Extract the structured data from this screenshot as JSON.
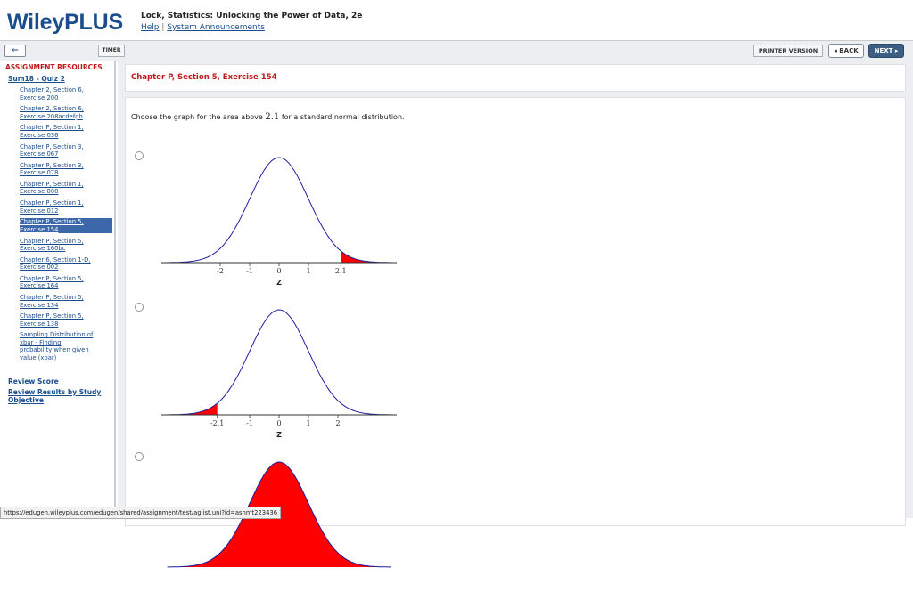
{
  "header": {
    "logo": "WileyPLUS",
    "course_title": "Lock, Statistics: Unlocking the Power of Data, 2e",
    "help_link": "Help",
    "separator": "|",
    "announcements_link": "System Announcements"
  },
  "toolbar": {
    "collapse_icon": "⇐",
    "timer": "TIMER",
    "printer_version": "PRINTER VERSION",
    "back": "◂ BACK",
    "next": "NEXT ▸"
  },
  "sidebar": {
    "heading": "ASSIGNMENT RESOURCES",
    "assignment": "Sum18 - Quiz 2",
    "items": [
      {
        "line1": "Chapter 2, Section 6,",
        "line2": "Exercise 200"
      },
      {
        "line1": "Chapter 2, Section 6,",
        "line2": "Exercise 208acdefgh"
      },
      {
        "line1": "Chapter P, Section 1,",
        "line2": "Exercise 036"
      },
      {
        "line1": "Chapter P, Section 3,",
        "line2": "Exercise 067"
      },
      {
        "line1": "Chapter P, Section 3,",
        "line2": "Exercise 078"
      },
      {
        "line1": "Chapter P, Section 1,",
        "line2": "Exercise 008"
      },
      {
        "line1": "Chapter P, Section 1,",
        "line2": "Exercise 012"
      },
      {
        "line1": "Chapter P, Section 5,",
        "line2": "Exercise 154"
      },
      {
        "line1": "Chapter P, Section 5,",
        "line2": "Exercise 160bc"
      },
      {
        "line1": "Chapter 6, Section 1-D,",
        "line2": "Exercise 002"
      },
      {
        "line1": "Chapter P, Section 5,",
        "line2": "Exercise 164"
      },
      {
        "line1": "Chapter P, Section 5,",
        "line2": "Exercise 134"
      },
      {
        "line1": "Chapter P, Section 5,",
        "line2": "Exercise 138"
      }
    ],
    "last_item": [
      "Sampling Distribution of",
      "xbar - Finding",
      "probability when given",
      "value (xbar)"
    ],
    "selected_index": 7,
    "review_score": "Review Score",
    "review_results": [
      "Review Results by Study",
      "Objective"
    ]
  },
  "main": {
    "exercise_title": "Chapter P, Section 5, Exercise 154",
    "question_prefix": "Choose the graph for the area above ",
    "question_value": "2.1",
    "question_suffix": " for a standard normal distribution."
  },
  "chart_data": [
    {
      "type": "area",
      "distribution": "standard normal",
      "shaded_region": {
        "from": 2.1,
        "to": "infinity"
      },
      "x_ticks": [
        "-2",
        "-1",
        "0",
        "1",
        "2.1"
      ],
      "xlabel": "Z",
      "curve_color": "#1e1e9e",
      "shade_color": "#ff0000"
    },
    {
      "type": "area",
      "distribution": "standard normal",
      "shaded_region": {
        "from": "-infinity",
        "to": -2.1
      },
      "x_ticks": [
        "-2.1",
        "-1",
        "0",
        "1",
        "2"
      ],
      "xlabel": "Z",
      "curve_color": "#1e1e9e",
      "shade_color": "#ff0000"
    },
    {
      "type": "area",
      "distribution": "standard normal",
      "shaded_region": {
        "from": "-infinity",
        "to": "infinity"
      },
      "x_ticks": [],
      "xlabel": "",
      "curve_color": "#1e1e9e",
      "shade_color": "#ff0000"
    }
  ],
  "status_bar": "https://edugen.wileyplus.com/edugen/shared/assignment/test/aglist.uni?id=asnmt223436"
}
